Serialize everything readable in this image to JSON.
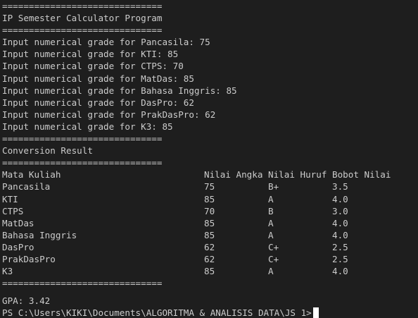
{
  "separator_top_short": "==============================",
  "title": "IP Semester Calculator Program",
  "separator": "==============================",
  "inputs": [
    "Input numerical grade for Pancasila: 75",
    "Input numerical grade for KTI: 85",
    "Input numerical grade for CTPS: 70",
    "Input numerical grade for MatDas: 85",
    "Input numerical grade for Bahasa Inggris: 85",
    "Input numerical grade for DasPro: 62",
    "Input numerical grade for PrakDasPro: 62",
    "Input numerical grade for K3: 85"
  ],
  "result_title": "Conversion Result",
  "table": {
    "headers": [
      "Mata Kuliah",
      "Nilai Angka",
      "Nilai Huruf",
      "Bobot Nilai"
    ],
    "rows": [
      [
        "Pancasila",
        "75",
        "B+",
        "3.5"
      ],
      [
        "KTI",
        "85",
        "A",
        "4.0"
      ],
      [
        "CTPS",
        "70",
        "B",
        "3.0"
      ],
      [
        "MatDas",
        "85",
        "A",
        "4.0"
      ],
      [
        "Bahasa Inggris",
        "85",
        "A",
        "4.0"
      ],
      [
        "DasPro",
        "62",
        "C+",
        "2.5"
      ],
      [
        "PrakDasPro",
        "62",
        "C+",
        "2.5"
      ],
      [
        "K3",
        "85",
        "A",
        "4.0"
      ]
    ]
  },
  "gpa": "GPA: 3.42",
  "prompt": "PS C:\\Users\\KIKI\\Documents\\ALGORITMA & ANALISIS DATA\\JS 1>"
}
